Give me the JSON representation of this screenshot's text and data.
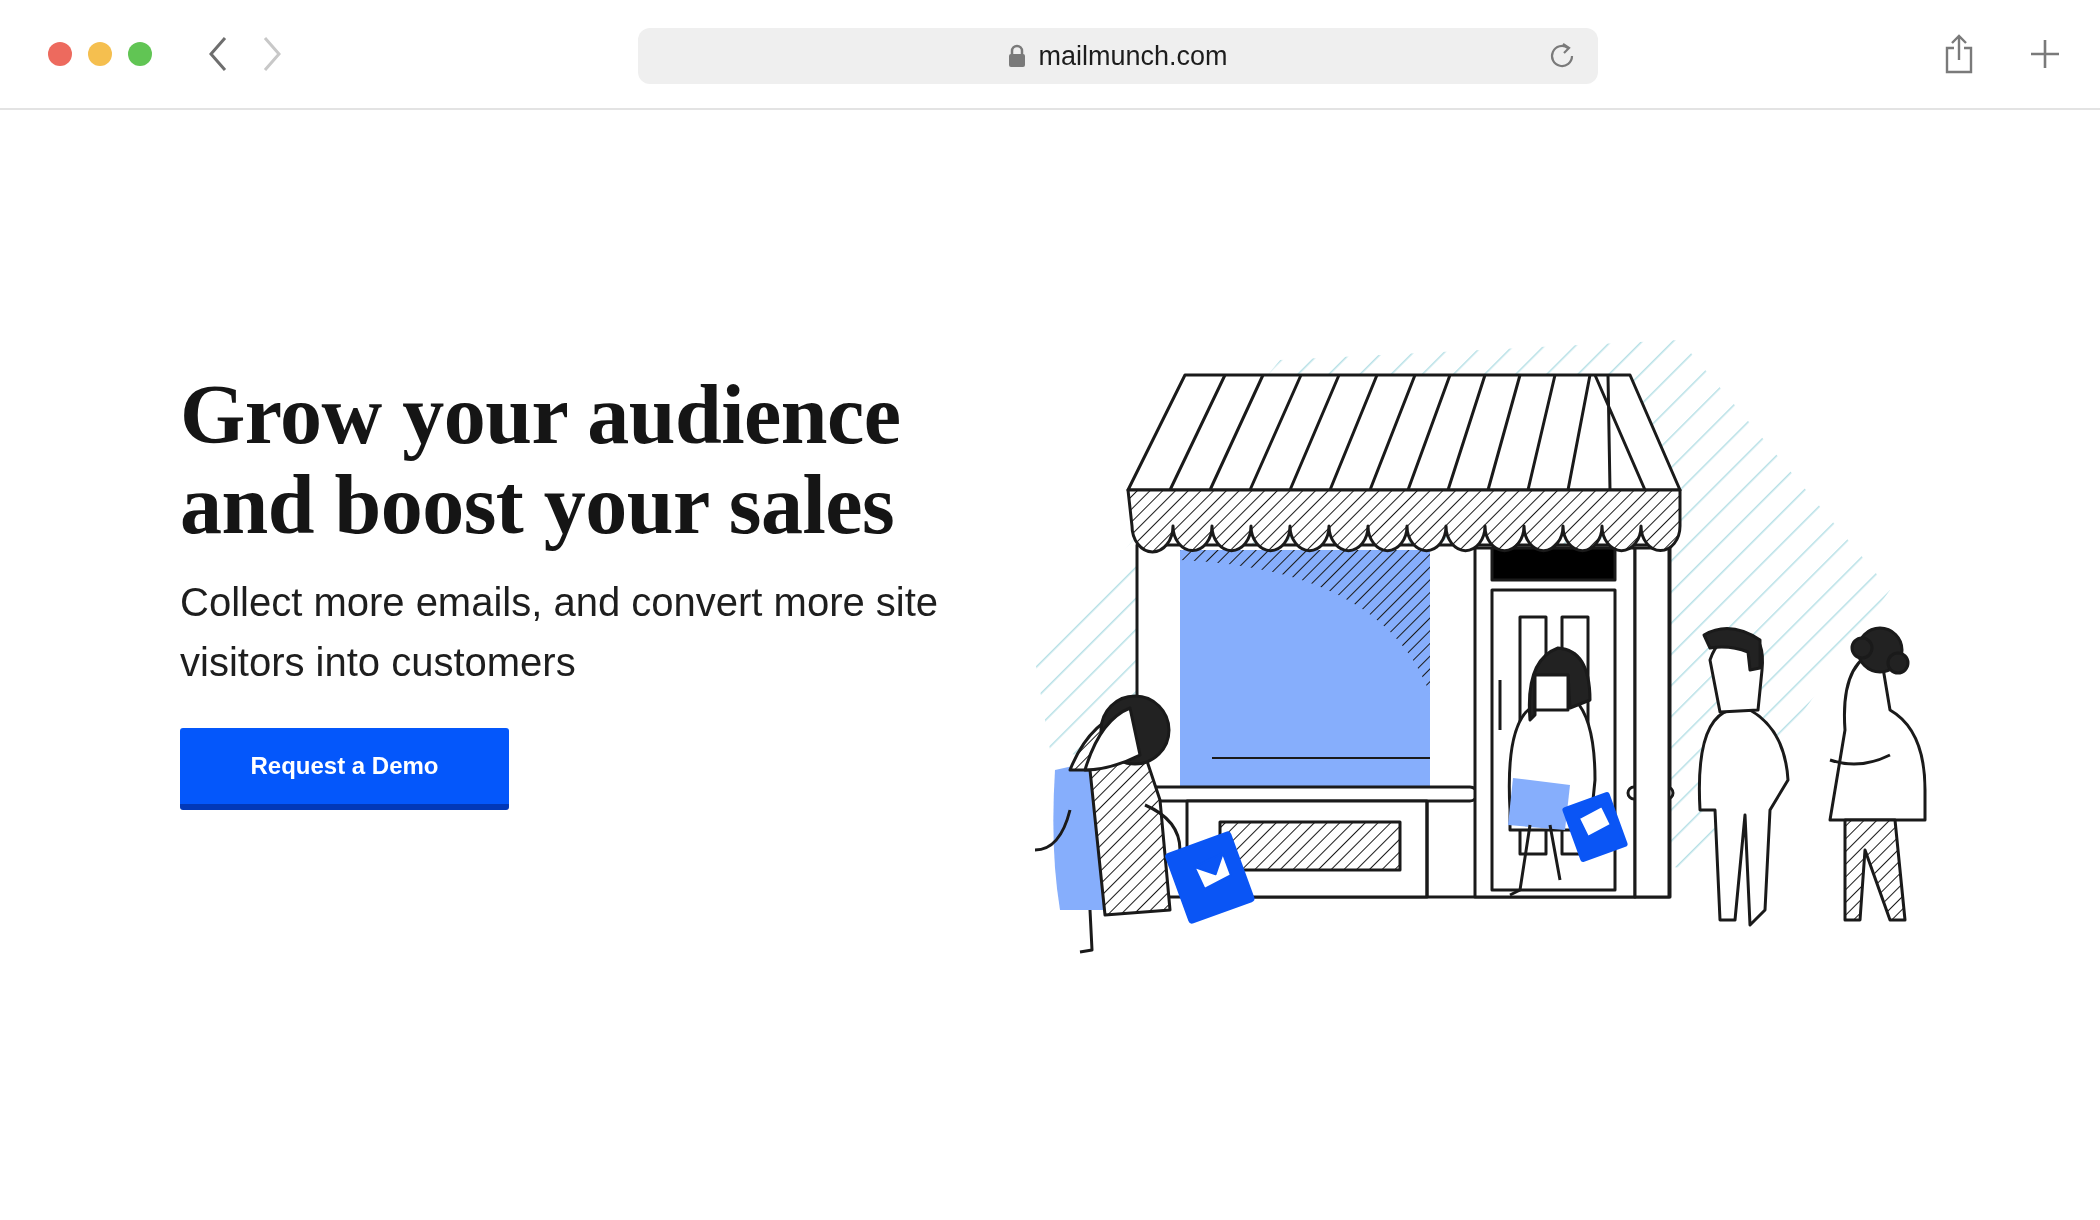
{
  "browser": {
    "url": "mailmunch.com",
    "back_disabled": false,
    "forward_disabled": true
  },
  "hero": {
    "heading": "Grow your audience and boost your sales",
    "subtitle": "Collect more emails, and convert more site visitors into customers",
    "button": "Request a Demo"
  }
}
